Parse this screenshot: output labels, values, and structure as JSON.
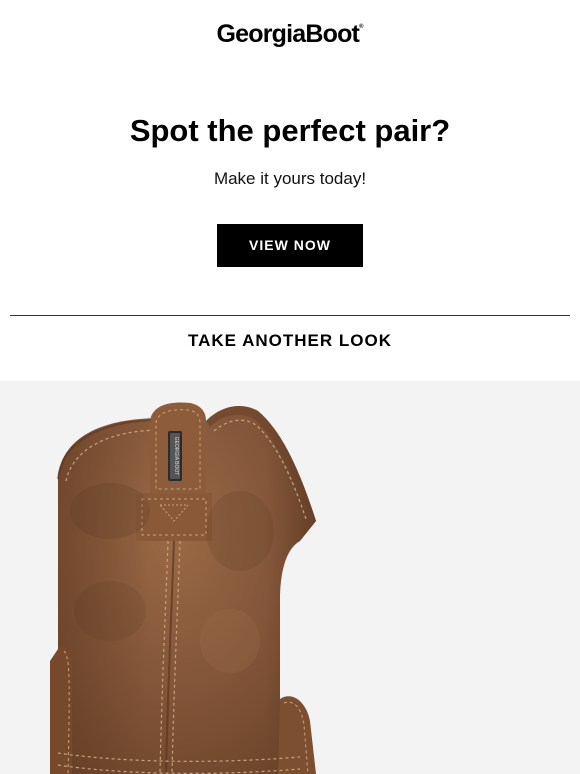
{
  "header": {
    "logo_text": "GeorgiaBoot",
    "logo_mark": "®"
  },
  "hero": {
    "headline": "Spot the perfect pair?",
    "subhead": "Make it yours today!",
    "cta_label": "VIEW NOW"
  },
  "section": {
    "title": "TAKE ANOTHER LOOK"
  },
  "product": {
    "image_subject": "brown leather pull-on boot",
    "pull_tab_text": "GEORGIA BOOT"
  },
  "colors": {
    "background": "#ffffff",
    "button_bg": "#000000",
    "button_text": "#ffffff",
    "product_bg": "#f3f3f3",
    "leather": "#8a5a38"
  }
}
